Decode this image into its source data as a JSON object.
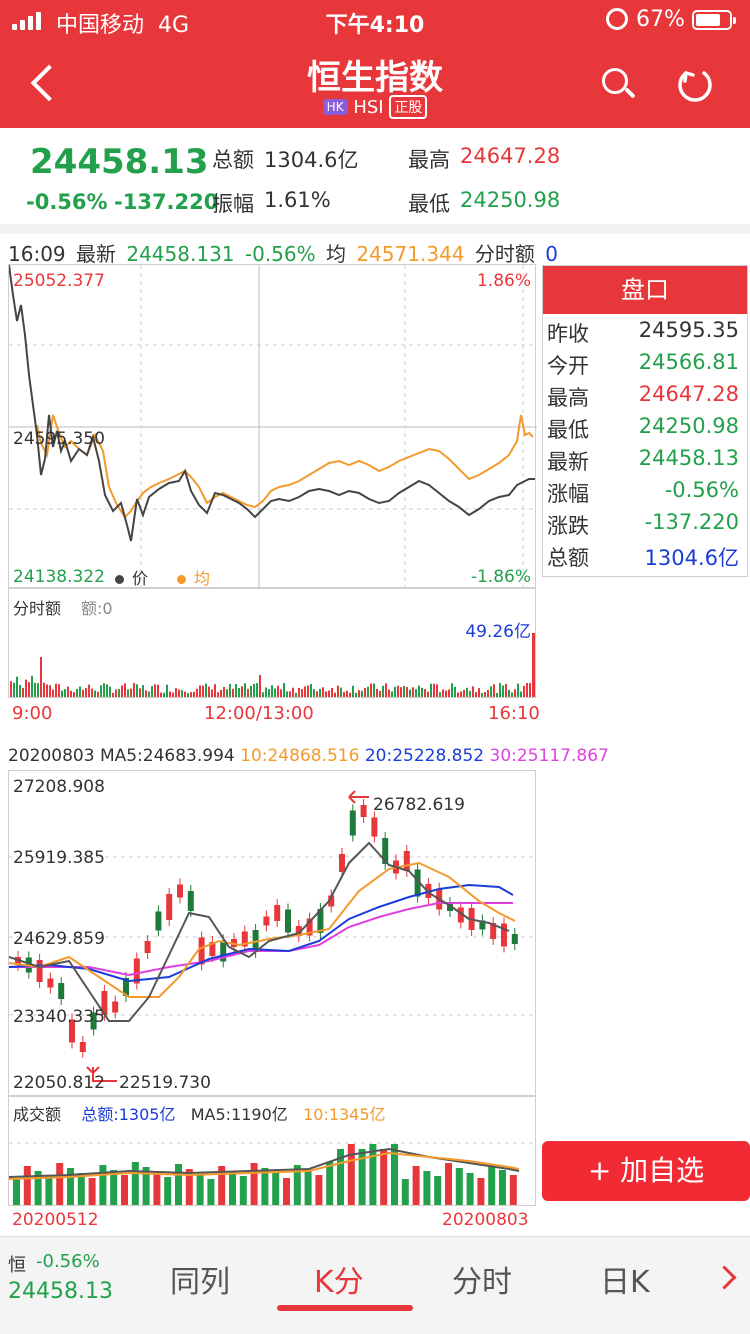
{
  "status_bar": {
    "carrier": "中国移动",
    "network": "4G",
    "time": "下午4:10",
    "battery": "67%"
  },
  "header": {
    "title": "恒生指数",
    "market_badge": "HK",
    "code": "HSI",
    "quality_badge": "正股"
  },
  "summary": {
    "price": "24458.13",
    "change_pct": "-0.56%",
    "change": "-137.220",
    "turnover_label": "总额",
    "turnover": "1304.6亿",
    "amplitude_label": "振幅",
    "amplitude": "1.61%",
    "high_label": "最高",
    "high": "24647.28",
    "low_label": "最低",
    "low": "24250.98"
  },
  "intraday": {
    "time": "16:09",
    "latest_label": "最新",
    "latest": "24458.131",
    "latest_pct": "-0.56%",
    "avg_label": "均",
    "avg": "24571.344",
    "amount_label": "分时额",
    "amount": "0",
    "y_top": "25052.377",
    "y_mid": "24595.350",
    "y_bottom": "24138.322",
    "pct_top": "1.86%",
    "pct_bottom": "-1.86%",
    "legend_price": "价",
    "legend_avg": "均",
    "vol_title": "分时额",
    "vol_amount": "额:0",
    "vol_max": "49.26亿",
    "x_start": "9:00",
    "x_mid": "12:00/13:00",
    "x_end": "16:10"
  },
  "pankou": {
    "title": "盘口",
    "rows": [
      {
        "label": "昨收",
        "value": "24595.35",
        "color": "#333333"
      },
      {
        "label": "今开",
        "value": "24566.81",
        "color": "#22a04b"
      },
      {
        "label": "最高",
        "value": "24647.28",
        "color": "#e8373a"
      },
      {
        "label": "最低",
        "value": "24250.98",
        "color": "#22a04b"
      },
      {
        "label": "最新",
        "value": "24458.13",
        "color": "#22a04b"
      },
      {
        "label": "涨幅",
        "value": "-0.56%",
        "color": "#22a04b"
      },
      {
        "label": "涨跌",
        "value": "-137.220",
        "color": "#22a04b"
      },
      {
        "label": "总额",
        "value": "1304.6亿",
        "color": "#1a3cd9"
      }
    ]
  },
  "kline": {
    "date": "20200803",
    "ma5": "MA5:24683.994",
    "ma10": "10:24868.516",
    "ma20": "20:25228.852",
    "ma30": "30:25117.867",
    "y_labels": [
      "27208.908",
      "25919.385",
      "24629.859",
      "23340.335",
      "22050.812"
    ],
    "max_mark": "26782.619",
    "min_mark": "22519.730",
    "vol_title": "成交额",
    "vol_total": "总额:1305亿",
    "vol_ma5": "MA5:1190亿",
    "vol_ma10": "10:1345亿",
    "x_start": "20200512",
    "x_end": "20200803"
  },
  "add_button": "+ 加自选",
  "tabbar": {
    "mini_name": "恒",
    "mini_pct": "-0.56%",
    "mini_price": "24458.13",
    "tabs": [
      "同列",
      "K分",
      "分时",
      "日K"
    ]
  },
  "colors": {
    "brand_red": "#e8373a",
    "down_green": "#22a04b",
    "avg_orange": "#f39a2b",
    "ma20_blue": "#1a3cd9",
    "ma30_magenta": "#e040e0"
  }
}
